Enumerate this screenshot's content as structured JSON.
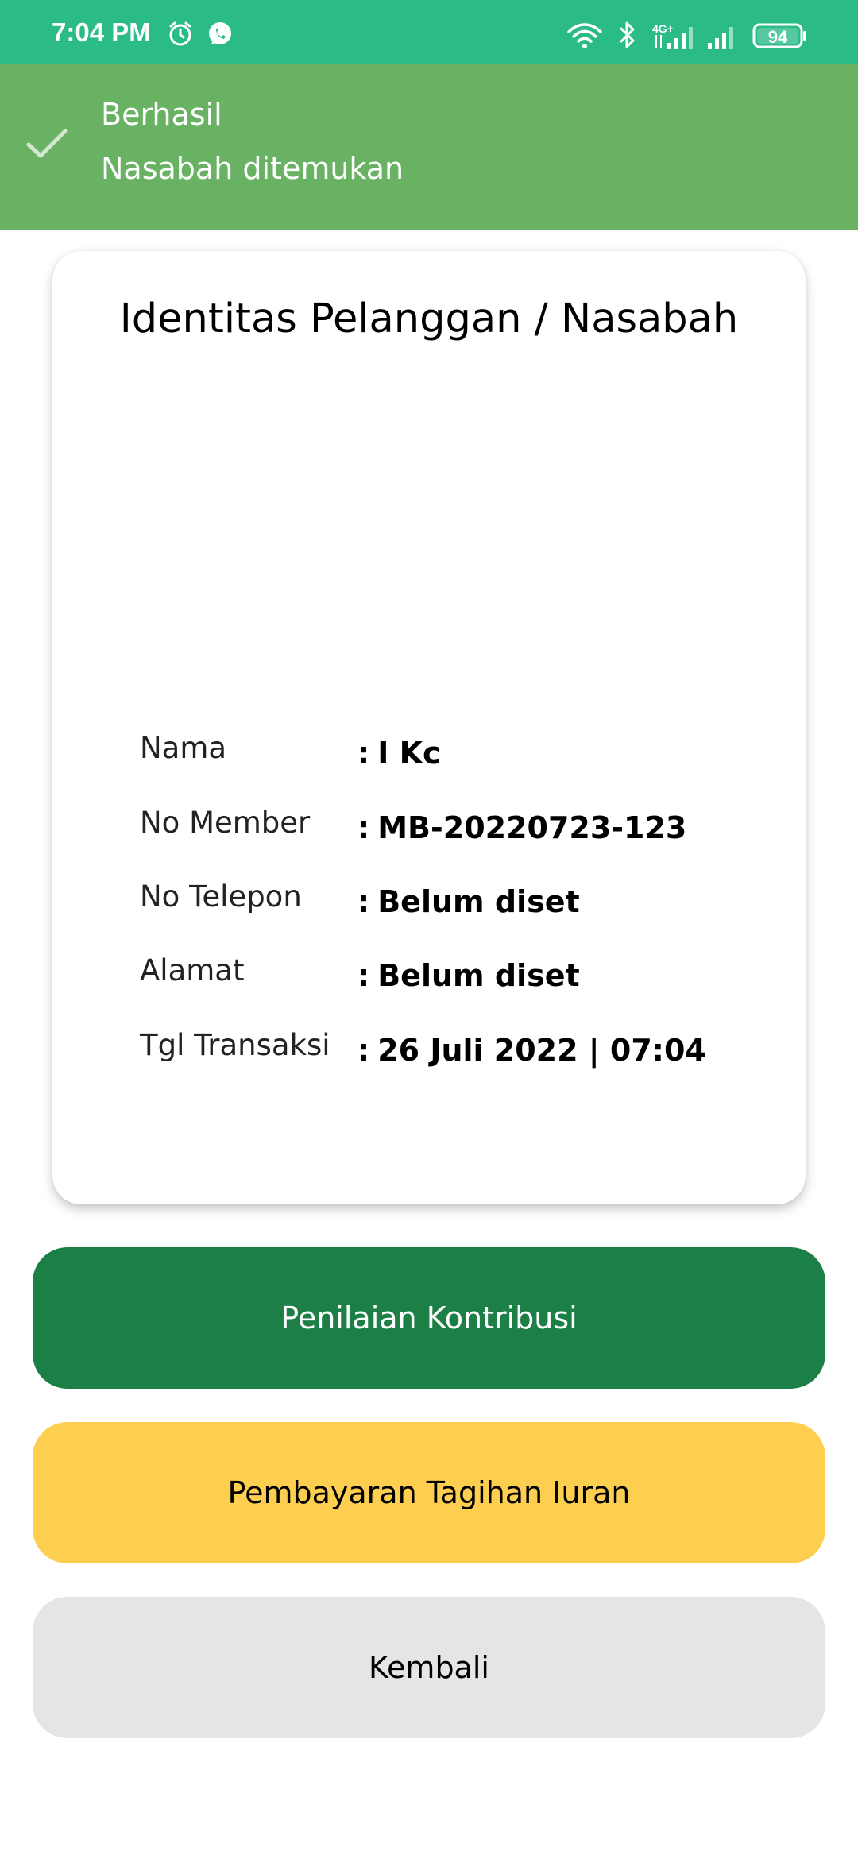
{
  "status_bar": {
    "time": "7:04 PM",
    "network_label": "4G+",
    "battery": "94",
    "icons": [
      "alarm-icon",
      "whatsapp-icon",
      "wifi-icon",
      "bluetooth-icon",
      "signal-icon",
      "signal-icon",
      "battery-icon"
    ]
  },
  "toast": {
    "title": "Berhasil",
    "message": "Nasabah ditemukan",
    "icon": "check-icon"
  },
  "card": {
    "title": "Identitas Pelanggan / Nasabah",
    "rows": [
      {
        "label": "Nama",
        "value": "I Kc"
      },
      {
        "label": "No Member",
        "value": "MB-20220723-123"
      },
      {
        "label": "No Telepon",
        "value": "Belum diset"
      },
      {
        "label": "Alamat",
        "value": "Belum diset"
      },
      {
        "label": "Tgl Transaksi",
        "value": "26 Juli 2022 | 07:04"
      }
    ]
  },
  "buttons": {
    "contribution": "Penilaian Kontribusi",
    "payment": "Pembayaran Tagihan Iuran",
    "back": "Kembali"
  },
  "colors": {
    "status_bar": "#2bbb87",
    "toast": "#69b263",
    "primary_button": "#1c7f46",
    "secondary_button": "#fdce4f",
    "back_button": "#e5e5e5"
  }
}
